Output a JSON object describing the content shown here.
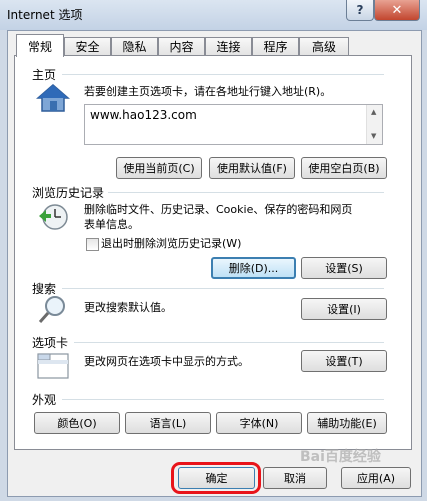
{
  "window": {
    "title": "Internet 选项",
    "help_label": "?",
    "close_label": "✕"
  },
  "tabs": [
    "常规",
    "安全",
    "隐私",
    "内容",
    "连接",
    "程序",
    "高级"
  ],
  "home": {
    "section_label": "主页",
    "description": "若要创建主页选项卡，请在各地址行键入地址(R)。",
    "address_value": "www.hao123.com",
    "buttons": [
      "使用当前页(C)",
      "使用默认值(F)",
      "使用空白页(B)"
    ]
  },
  "history": {
    "section_label": "浏览历史记录",
    "description_line1": "删除临时文件、历史记录、Cookie、保存的密码和网页",
    "description_line2": "表单信息。",
    "checkbox_label": "退出时删除浏览历史记录(W)",
    "checkbox_checked": false,
    "delete_button": "删除(D)...",
    "settings_button": "设置(S)"
  },
  "search": {
    "section_label": "搜索",
    "description": "更改搜索默认值。",
    "settings_button": "设置(I)"
  },
  "tabs_section": {
    "section_label": "选项卡",
    "description": "更改网页在选项卡中显示的方式。",
    "settings_button": "设置(T)"
  },
  "appearance": {
    "section_label": "外观",
    "buttons": [
      "颜色(O)",
      "语言(L)",
      "字体(N)",
      "辅助功能(E)"
    ]
  },
  "footer": {
    "ok": "确定",
    "cancel": "取消",
    "apply": "应用(A)"
  },
  "watermark": "Bai百度经验",
  "colors": {
    "highlight": "#e8141a",
    "focus_border": "#3c7fb1"
  }
}
